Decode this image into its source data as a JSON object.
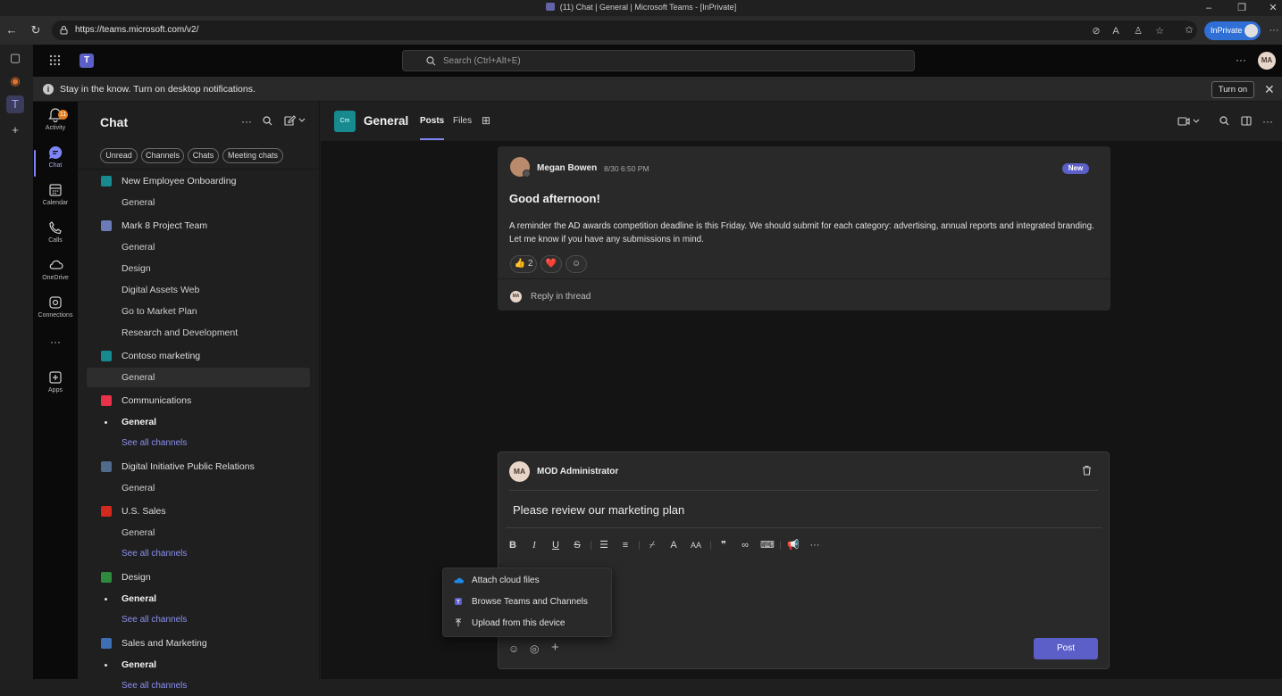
{
  "browser": {
    "window_title": "(11) Chat | General | Microsoft Teams - [InPrivate]",
    "url": "https://teams.microsoft.com/v2/",
    "inprivate_label": "InPrivate"
  },
  "teams_header": {
    "search_placeholder": "Search (Ctrl+Alt+E)",
    "user_initials": "MA"
  },
  "notification": {
    "message": "Stay in the know. Turn on desktop notifications.",
    "button": "Turn on"
  },
  "appbar": {
    "activity_badge": "11",
    "items": [
      {
        "label": "Activity",
        "icon": "bell-icon"
      },
      {
        "label": "Chat",
        "icon": "chat-icon"
      },
      {
        "label": "Calendar",
        "icon": "calendar-icon"
      },
      {
        "label": "Calls",
        "icon": "phone-icon"
      },
      {
        "label": "OneDrive",
        "icon": "cloud-icon"
      },
      {
        "label": "Connections",
        "icon": "connections-icon"
      },
      {
        "label": "Apps",
        "icon": "apps-icon"
      }
    ],
    "more": "···"
  },
  "listpane": {
    "title": "Chat",
    "filters": [
      "Unread",
      "Channels",
      "Chats",
      "Meeting chats"
    ],
    "entries": [
      {
        "kind": "team",
        "name": "New Employee Onboarding",
        "color": "#178a8f"
      },
      {
        "kind": "channel",
        "name": "General"
      },
      {
        "kind": "team",
        "name": "Mark 8 Project Team",
        "color": "#6b7bb8"
      },
      {
        "kind": "channel",
        "name": "General"
      },
      {
        "kind": "channel",
        "name": "Design"
      },
      {
        "kind": "channel",
        "name": "Digital Assets Web"
      },
      {
        "kind": "channel",
        "name": "Go to Market Plan"
      },
      {
        "kind": "channel",
        "name": "Research and Development"
      },
      {
        "kind": "team",
        "name": "Contoso marketing",
        "color": "#178a8f"
      },
      {
        "kind": "channel",
        "name": "General",
        "selected": true
      },
      {
        "kind": "team",
        "name": "Communications",
        "color": "#e8324a"
      },
      {
        "kind": "channel",
        "name": "General",
        "bold": true
      },
      {
        "kind": "link",
        "name": "See all channels"
      },
      {
        "kind": "team",
        "name": "Digital Initiative Public Relations",
        "color": "#4f6a8a"
      },
      {
        "kind": "channel",
        "name": "General"
      },
      {
        "kind": "team",
        "name": "U.S. Sales",
        "color": "#d42a1e"
      },
      {
        "kind": "channel",
        "name": "General"
      },
      {
        "kind": "link",
        "name": "See all channels"
      },
      {
        "kind": "team",
        "name": "Design",
        "color": "#2e8b3e"
      },
      {
        "kind": "channel",
        "name": "General",
        "bold": true
      },
      {
        "kind": "link",
        "name": "See all channels"
      },
      {
        "kind": "team",
        "name": "Sales and Marketing",
        "color": "#3e6fb5"
      },
      {
        "kind": "channel",
        "name": "General",
        "bold": true
      },
      {
        "kind": "link",
        "name": "See all channels"
      }
    ]
  },
  "channel": {
    "avatar_text": "Cm",
    "name": "General",
    "tabs": [
      "Posts",
      "Files"
    ]
  },
  "post": {
    "author": "Megan Bowen",
    "time": "8/30 6:50 PM",
    "badge": "New",
    "subject": "Good afternoon!",
    "body": "A reminder the AD awards competition deadline is this Friday. We should submit for each category: advertising, annual reports and integrated branding.  Let me know if you have any submissions in mind.",
    "reactions": [
      {
        "emoji": "👍",
        "count": "2"
      },
      {
        "emoji": "❤️",
        "count": ""
      }
    ],
    "reply_avatar": "MA",
    "reply_label": "Reply in thread"
  },
  "compose": {
    "author_initials": "MA",
    "author": "MOD Administrator",
    "text": "Please review our marketing plan",
    "toolbar": [
      "B",
      "I",
      "U",
      "S"
    ],
    "post_button": "Post"
  },
  "attach_menu": {
    "items": [
      "Attach cloud files",
      "Browse Teams and Channels",
      "Upload from this device"
    ]
  }
}
